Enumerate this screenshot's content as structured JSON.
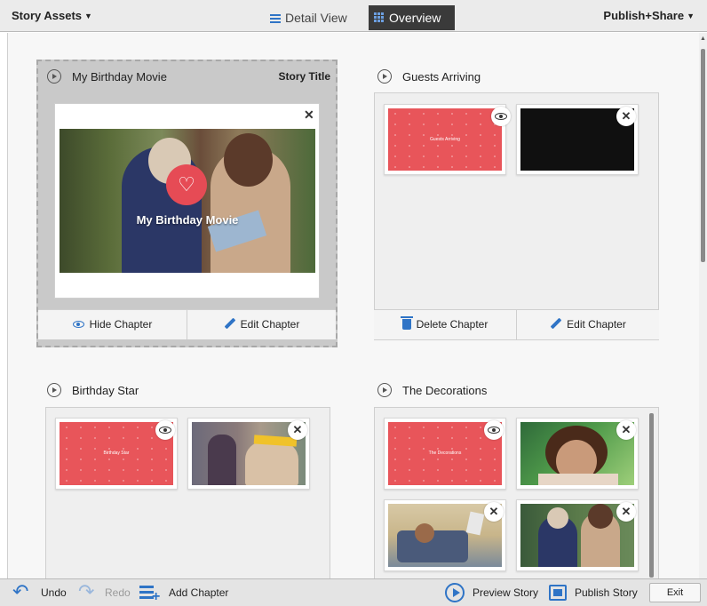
{
  "topbar": {
    "story_assets": "Story Assets",
    "publish_share": "Publish+Share",
    "tabs": [
      {
        "label": "Detail View",
        "active": false
      },
      {
        "label": "Overview",
        "active": true
      }
    ]
  },
  "chapters": [
    {
      "title": "My Birthday Movie",
      "tag": "Story Title",
      "caption": "My Birthday Movie",
      "actions": [
        "Hide Chapter",
        "Edit Chapter"
      ]
    },
    {
      "title": "Guests Arriving",
      "card_text": "Guests Arriving",
      "actions": [
        "Delete Chapter",
        "Edit Chapter"
      ]
    },
    {
      "title": "Birthday Star",
      "card_text": "Birthday Star"
    },
    {
      "title": "The Decorations",
      "card_text": "The Decorations"
    }
  ],
  "bottom": {
    "undo": "Undo",
    "redo": "Redo",
    "add_chapter": "Add Chapter",
    "preview_story": "Preview Story",
    "publish_story": "Publish Story",
    "exit": "Exit"
  },
  "colors": {
    "accent": "#2f74c6",
    "card_red": "#e8555a",
    "toolbar_active": "#3a3a3a",
    "heart": "#e64b55"
  },
  "icons": {
    "caret": "▼",
    "close": "✕",
    "heart": "♡",
    "undo": "↶",
    "redo": "↷",
    "scroll_up": "▲"
  }
}
